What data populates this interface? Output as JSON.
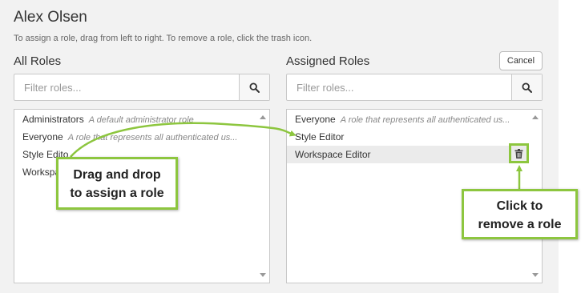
{
  "user": {
    "name": "Alex Olsen"
  },
  "instructions": "To assign a role, drag from left to right. To remove a role, click the trash icon.",
  "all_roles": {
    "label": "All Roles",
    "filter_placeholder": "Filter roles...",
    "items": [
      {
        "name": "Administrators",
        "desc": "A default administrator role"
      },
      {
        "name": "Everyone",
        "desc": "A role that represents all authenticated us..."
      },
      {
        "name": "Style Edito",
        "desc": ""
      },
      {
        "name": "Workspac",
        "desc": ""
      }
    ]
  },
  "assigned_roles": {
    "label": "Assigned Roles",
    "filter_placeholder": "Filter roles...",
    "items": [
      {
        "name": "Everyone",
        "desc": "A role that represents all authenticated us..."
      },
      {
        "name": "Style Editor",
        "desc": ""
      },
      {
        "name": "Workspace Editor",
        "desc": ""
      }
    ]
  },
  "cancel_label": "Cancel",
  "callouts": {
    "drag": [
      "Drag and drop",
      "to assign a role"
    ],
    "click": [
      "Click to",
      "remove a role"
    ]
  },
  "colors": {
    "accent": "#8dc63f",
    "panel_bg": "#f2f2f2",
    "highlight_row": "#ebebeb"
  },
  "icons": {
    "search": "search-icon",
    "trash": "trash-icon"
  }
}
